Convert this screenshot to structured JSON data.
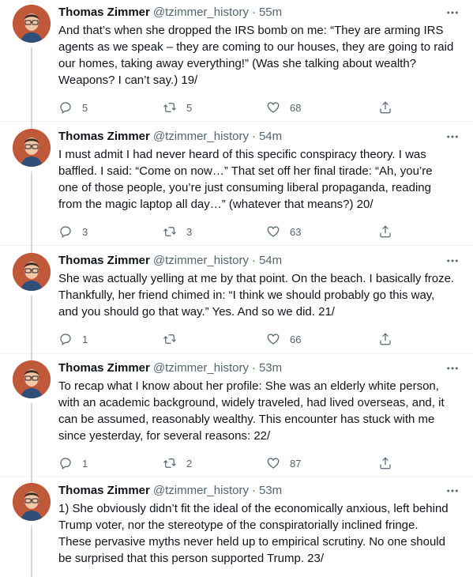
{
  "tweets": [
    {
      "name": "Thomas Zimmer",
      "handle": "@tzimmer_history",
      "time": "55m",
      "text": "And that’s when she dropped the IRS bomb on me: “They are arming IRS\nagents as we speak – they are coming to our houses, they are going to raid\nour homes, taking away everything!” (Was she talking about wealth?\nWeapons? I can’t say.) 19/",
      "replies": "5",
      "retweets": "5",
      "likes": "68"
    },
    {
      "name": "Thomas Zimmer",
      "handle": "@tzimmer_history",
      "time": "54m",
      "text": "I must admit I had never heard of this specific conspiracy theory. I was\nbaffled. I said: “Come on now…” That set off her final tirade: “Ah, you’re\none of those people, you’re just consuming liberal propaganda, reading\nfrom the magic laptop all day…” (whatever that means?) 20/",
      "replies": "3",
      "retweets": "3",
      "likes": "63"
    },
    {
      "name": "Thomas Zimmer",
      "handle": "@tzimmer_history",
      "time": "54m",
      "text": "She was actually yelling at me by that point. On the beach. I basically froze.\nThankfully, her friend chimed in: “I think we should probably go this way,\nand you should go that way.” Yes. And so we did. 21/",
      "replies": "1",
      "retweets": "",
      "likes": "66"
    },
    {
      "name": "Thomas Zimmer",
      "handle": "@tzimmer_history",
      "time": "53m",
      "text": "To recap what I know about her profile: She was an elderly white person,\nwith an academic background, widely traveled, had lived overseas, and, it\ncan be assumed, reasonably wealthy. This encounter has stuck with me\nsince yesterday, for several reasons: 22/",
      "replies": "1",
      "retweets": "2",
      "likes": "87"
    },
    {
      "name": "Thomas Zimmer",
      "handle": "@tzimmer_history",
      "time": "53m",
      "text": "1) She obviously didn’t fit the ideal of the economically anxious, left behind\nTrump voter, nor the stereotype of the conspiratorially inclined fringe.\nThese pervasive myths never held up to empirical scrutiny. No one should\nbe surprised that this person supported Trump. 23/"
    }
  ],
  "icons": {
    "more": "more-icon",
    "reply": "reply-icon",
    "retweet": "retweet-icon",
    "like": "heart-icon",
    "share": "share-icon"
  },
  "colors": {
    "text": "#0f1419",
    "secondary": "#536471",
    "thread_line": "#cfd9de",
    "divider": "#eff3f4",
    "avatar_bg": "#c0593a"
  }
}
